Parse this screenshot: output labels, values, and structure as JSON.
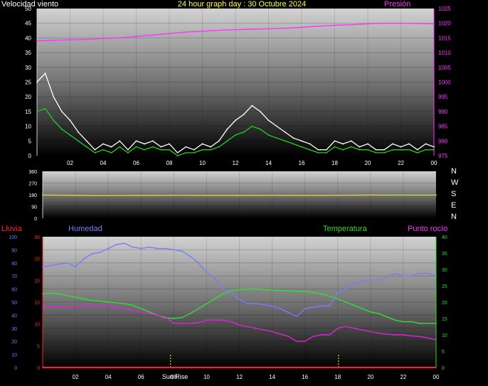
{
  "header": {
    "wind_label": "Velocidad viento",
    "title": "24 hour graph day : 30 Octubre 2024",
    "pressure_label": "Presión"
  },
  "direction_labels": [
    "N",
    "W",
    "S",
    "E",
    "N"
  ],
  "bottom_labels": {
    "rain": "Lluvia",
    "humidity": "Humedad",
    "temperature": "Temperatura",
    "dewpoint": "Punto rocío",
    "sunrise": "Sun Rise"
  },
  "colors": {
    "wind_gust": "#ffffff",
    "wind_avg": "#22cc22",
    "pressure": "#ff33ff",
    "direction": "#dddd33",
    "humidity": "#7a7aff",
    "temperature": "#33dd33",
    "dewpoint": "#dd22dd",
    "rain": "#ff2222",
    "sun": "#ffff00"
  },
  "chart_data": [
    {
      "type": "line",
      "panel": "wind",
      "x_ticks": [
        "02",
        "04",
        "06",
        "08",
        "10",
        "12",
        "14",
        "16",
        "18",
        "20",
        "22",
        "00"
      ],
      "y_left_ticks": [
        "0",
        "5",
        "10",
        "15",
        "20",
        "25",
        "30",
        "35",
        "40",
        "45",
        "50"
      ],
      "y_left_range": [
        0,
        50
      ],
      "y_right_ticks": [
        "975",
        "980",
        "985",
        "990",
        "995",
        "1000",
        "1005",
        "1010",
        "1015",
        "1020",
        "1025"
      ],
      "y_right_range": [
        975,
        1025
      ],
      "series": [
        {
          "name": "Velocidad viento",
          "key": "gust",
          "axis": "left",
          "x": [
            0,
            0.5,
            1,
            1.5,
            2,
            2.5,
            3,
            3.5,
            4,
            4.5,
            5,
            5.5,
            6,
            6.5,
            7,
            7.5,
            8,
            8.5,
            9,
            9.5,
            10,
            10.5,
            11,
            11.5,
            12,
            12.5,
            13,
            13.5,
            14,
            14.5,
            15,
            15.5,
            16,
            16.5,
            17,
            17.5,
            18,
            18.5,
            19,
            19.5,
            20,
            20.5,
            21,
            21.5,
            22,
            22.5,
            23,
            23.5,
            24
          ],
          "values": [
            25,
            28,
            20,
            15,
            12,
            8,
            5,
            2,
            4,
            3,
            5,
            2,
            5,
            4,
            5,
            3,
            4,
            1,
            3,
            2,
            4,
            3,
            5,
            9,
            12,
            14,
            17,
            15,
            12,
            10,
            8,
            6,
            5,
            4,
            2,
            2,
            5,
            4,
            5,
            3,
            4,
            2,
            2,
            4,
            3,
            4,
            2,
            4,
            3
          ]
        },
        {
          "name": "wind-average",
          "key": "avg",
          "axis": "left",
          "x": [
            0,
            0.5,
            1,
            1.5,
            2,
            2.5,
            3,
            3.5,
            4,
            4.5,
            5,
            5.5,
            6,
            6.5,
            7,
            7.5,
            8,
            8.5,
            9,
            9.5,
            10,
            10.5,
            11,
            11.5,
            12,
            12.5,
            13,
            13.5,
            14,
            14.5,
            15,
            15.5,
            16,
            16.5,
            17,
            17.5,
            18,
            18.5,
            19,
            19.5,
            20,
            20.5,
            21,
            21.5,
            22,
            22.5,
            23,
            23.5,
            24
          ],
          "values": [
            15,
            16,
            12,
            9,
            7,
            5,
            3,
            1,
            2,
            1,
            3,
            1,
            3,
            2,
            3,
            2,
            2,
            0,
            1,
            1,
            2,
            2,
            3,
            5,
            7,
            8,
            10,
            9,
            7,
            6,
            5,
            4,
            3,
            2,
            1,
            1,
            3,
            2,
            3,
            2,
            2,
            1,
            1,
            2,
            2,
            2,
            1,
            2,
            2
          ]
        },
        {
          "name": "Presión",
          "key": "pressure",
          "axis": "right",
          "x": [
            0,
            1,
            2,
            3,
            4,
            5,
            6,
            7,
            8,
            9,
            10,
            11,
            12,
            13,
            14,
            15,
            16,
            17,
            18,
            19,
            20,
            21,
            22,
            23,
            24
          ],
          "values": [
            1014,
            1014.2,
            1014.4,
            1014.5,
            1014.8,
            1015,
            1015.5,
            1016,
            1016.5,
            1017,
            1017.3,
            1017.6,
            1017.8,
            1018,
            1018.1,
            1018.3,
            1018.6,
            1019,
            1019.3,
            1019.5,
            1019.8,
            1020,
            1020,
            1019.9,
            1019.8
          ]
        }
      ]
    },
    {
      "type": "line",
      "panel": "direction",
      "x_ticks": [
        "02",
        "04",
        "06",
        "08",
        "10",
        "12",
        "14",
        "16",
        "18",
        "20",
        "22",
        "00"
      ],
      "y_ticks": [
        "0",
        "90",
        "180",
        "270",
        "360"
      ],
      "y_range": [
        0,
        360
      ],
      "series": [
        {
          "name": "wind-direction",
          "key": "direction",
          "x": [
            0,
            2,
            4,
            6,
            8,
            10,
            12,
            14,
            16,
            18,
            20,
            22,
            24
          ],
          "values": [
            178,
            176,
            175,
            176,
            177,
            176,
            176,
            177,
            176,
            177,
            178,
            178,
            178
          ]
        }
      ]
    },
    {
      "type": "line",
      "panel": "weather",
      "x_ticks": [
        "02",
        "04",
        "06",
        "08",
        "10",
        "12",
        "14",
        "16",
        "18",
        "20",
        "22",
        "00"
      ],
      "y_humidity_ticks": [
        "0",
        "10",
        "20",
        "30",
        "40",
        "50",
        "60",
        "70",
        "80",
        "90",
        "100"
      ],
      "y_humidity_range": [
        0,
        100
      ],
      "y_rain_ticks": [
        "0",
        "5",
        "10",
        "15",
        "20",
        "25",
        "30"
      ],
      "y_rain_range": [
        0,
        30
      ],
      "y_temp_ticks": [
        "0",
        "5",
        "10",
        "15",
        "20",
        "25",
        "30",
        "35",
        "40"
      ],
      "y_temp_range": [
        0,
        40
      ],
      "sunrise_hour": 7.8,
      "sunset_hour": 18.05,
      "series": [
        {
          "name": "Humedad",
          "key": "humidity",
          "axis": "humidity",
          "x": [
            0,
            0.5,
            1,
            1.5,
            2,
            2.5,
            3,
            3.5,
            4,
            4.5,
            5,
            5.5,
            6,
            6.5,
            7,
            7.5,
            8,
            8.5,
            9,
            9.5,
            10,
            10.5,
            11,
            11.5,
            12,
            12.5,
            13,
            13.5,
            14,
            14.5,
            15,
            15.5,
            16,
            16.5,
            17,
            17.5,
            18,
            18.5,
            19,
            19.5,
            20,
            20.5,
            21,
            21.5,
            22,
            22.5,
            23,
            23.5,
            24
          ],
          "values": [
            77,
            78,
            79,
            80,
            77,
            83,
            87,
            88,
            91,
            94,
            95,
            92,
            91,
            92,
            91,
            91,
            90,
            89,
            85,
            80,
            73,
            68,
            60,
            57,
            52,
            49,
            49,
            48,
            47,
            45,
            42,
            39,
            45,
            46,
            47,
            47,
            57,
            60,
            64,
            66,
            67,
            67,
            69,
            72,
            70,
            70,
            72,
            72,
            70
          ]
        },
        {
          "name": "Temperatura",
          "key": "temperature",
          "axis": "temp",
          "x": [
            0,
            0.5,
            1,
            1.5,
            2,
            2.5,
            3,
            3.5,
            4,
            4.5,
            5,
            5.5,
            6,
            6.5,
            7,
            7.5,
            8,
            8.5,
            9,
            9.5,
            10,
            10.5,
            11,
            11.5,
            12,
            12.5,
            13,
            13.5,
            14,
            14.5,
            15,
            15.5,
            16,
            16.5,
            17,
            17.5,
            18,
            18.5,
            19,
            19.5,
            20,
            20.5,
            21,
            21.5,
            22,
            22.5,
            23,
            23.5,
            24
          ],
          "values": [
            22.5,
            22.8,
            22.5,
            22,
            21.5,
            21,
            20.5,
            20.3,
            20,
            19.8,
            19.5,
            19,
            18,
            17,
            16,
            15.2,
            15,
            15.3,
            16.5,
            18,
            19.5,
            21,
            22.5,
            23.5,
            23.8,
            24,
            24,
            23.8,
            23.7,
            23.5,
            23.5,
            23.3,
            23.3,
            23,
            22.5,
            21.8,
            21,
            20,
            19,
            18,
            17,
            16.5,
            15.5,
            14.5,
            14,
            14,
            13.5,
            13.5,
            13.5
          ]
        },
        {
          "name": "Punto rocío",
          "key": "dewpoint",
          "axis": "temp",
          "x": [
            0,
            0.5,
            1,
            1.5,
            2,
            2.5,
            3,
            3.5,
            4,
            4.5,
            5,
            5.5,
            6,
            6.5,
            7,
            7.5,
            8,
            8.5,
            9,
            9.5,
            10,
            10.5,
            11,
            11.5,
            12,
            12.5,
            13,
            13.5,
            14,
            14.5,
            15,
            15.5,
            16,
            16.5,
            17,
            17.5,
            18,
            18.5,
            19,
            19.5,
            20,
            20.5,
            21,
            21.5,
            22,
            22.5,
            23,
            23.5,
            24
          ],
          "values": [
            18.5,
            18.7,
            18.5,
            18.5,
            18.5,
            18.8,
            19,
            19,
            18.8,
            18.5,
            18,
            17.5,
            17,
            16.5,
            16,
            15.5,
            13.5,
            13.5,
            13.5,
            13.7,
            14.5,
            14.5,
            14.5,
            14,
            13,
            12.5,
            12,
            11.5,
            11,
            10.2,
            9.5,
            8,
            8,
            9.5,
            10,
            10,
            12,
            12.5,
            12,
            11.5,
            11,
            10.5,
            10.2,
            10,
            10,
            9.7,
            9.5,
            9,
            8.5
          ]
        },
        {
          "name": "Lluvia",
          "key": "rain",
          "axis": "rain",
          "x": [
            0,
            24
          ],
          "values": [
            0,
            0
          ]
        }
      ]
    }
  ]
}
